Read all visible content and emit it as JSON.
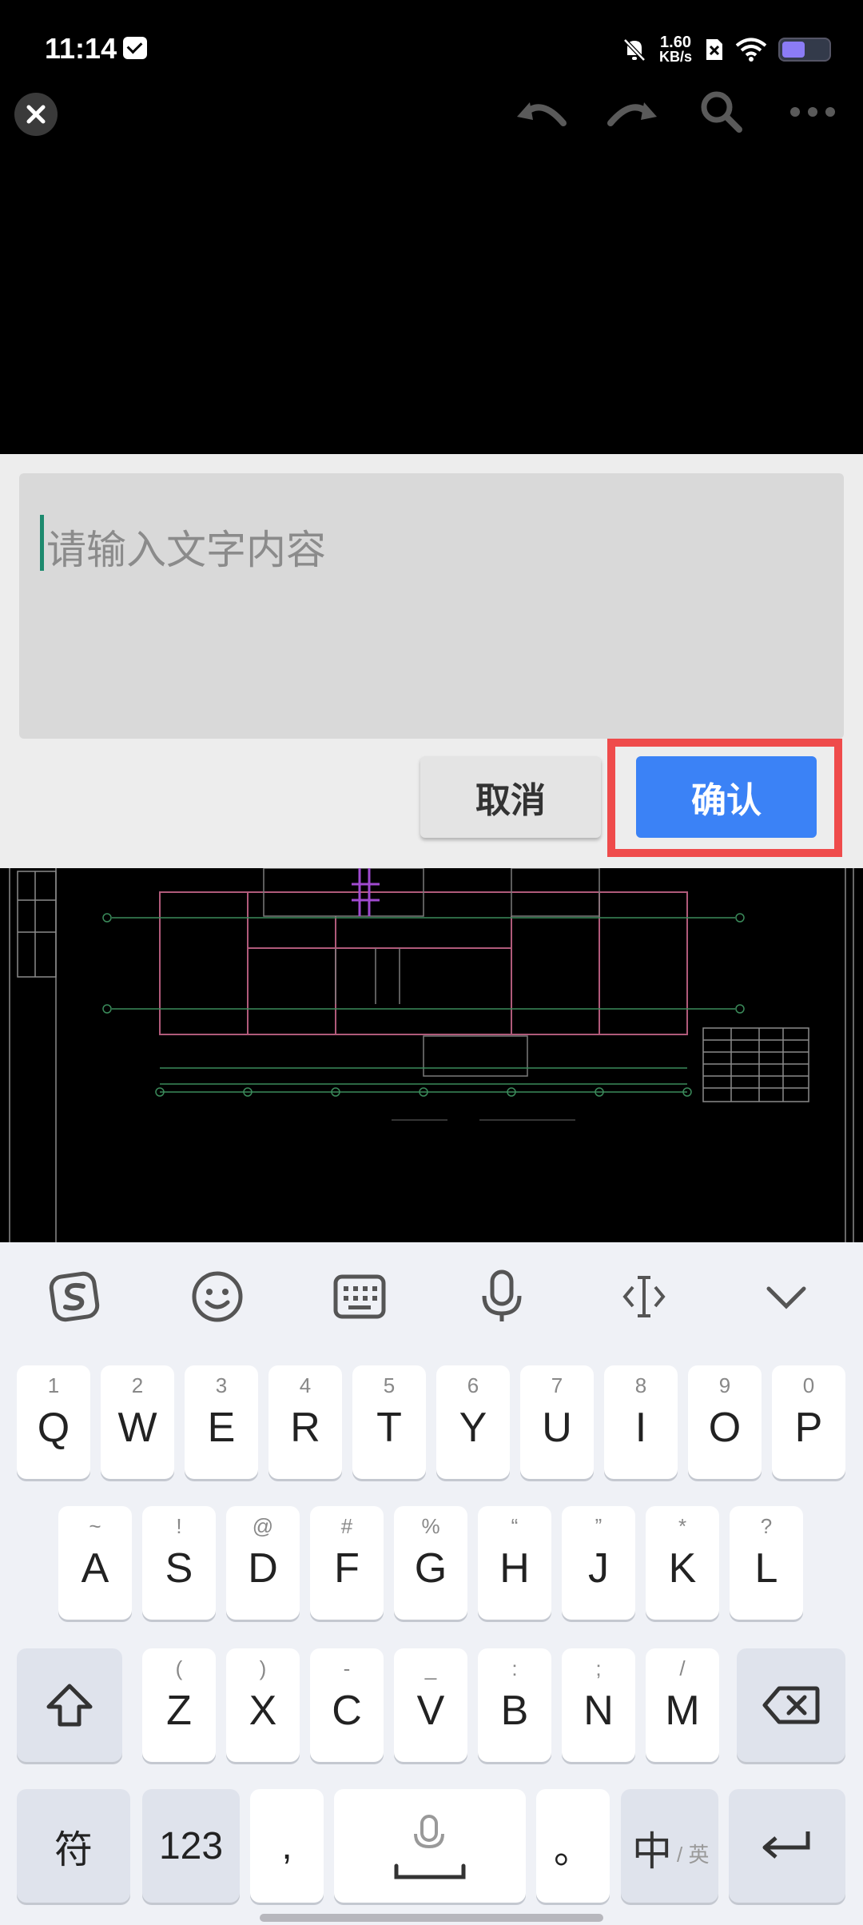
{
  "status_bar": {
    "time": "11:14",
    "net_speed_value": "1.60",
    "net_speed_unit": "KB/s"
  },
  "icons": {
    "close": "close-icon",
    "undo": "undo-icon",
    "redo": "redo-icon",
    "search": "search-icon",
    "more": "more-icon"
  },
  "text_panel": {
    "placeholder": "请输入文字内容",
    "cancel_label": "取消",
    "confirm_label": "确认"
  },
  "colors": {
    "confirm": "#3b82f6",
    "highlight": "#ef4b4b",
    "caret": "#1d8a6e"
  },
  "keyboard": {
    "row1": [
      {
        "main": "Q",
        "sub": "1"
      },
      {
        "main": "W",
        "sub": "2"
      },
      {
        "main": "E",
        "sub": "3"
      },
      {
        "main": "R",
        "sub": "4"
      },
      {
        "main": "T",
        "sub": "5"
      },
      {
        "main": "Y",
        "sub": "6"
      },
      {
        "main": "U",
        "sub": "7"
      },
      {
        "main": "I",
        "sub": "8"
      },
      {
        "main": "O",
        "sub": "9"
      },
      {
        "main": "P",
        "sub": "0"
      }
    ],
    "row2": [
      {
        "main": "A",
        "sub": "~"
      },
      {
        "main": "S",
        "sub": "!"
      },
      {
        "main": "D",
        "sub": "@"
      },
      {
        "main": "F",
        "sub": "#"
      },
      {
        "main": "G",
        "sub": "%"
      },
      {
        "main": "H",
        "sub": "“"
      },
      {
        "main": "J",
        "sub": "”"
      },
      {
        "main": "K",
        "sub": "*"
      },
      {
        "main": "L",
        "sub": "?"
      }
    ],
    "row3": [
      {
        "main": "Z",
        "sub": "("
      },
      {
        "main": "X",
        "sub": ")"
      },
      {
        "main": "C",
        "sub": "-"
      },
      {
        "main": "V",
        "sub": "_"
      },
      {
        "main": "B",
        "sub": ":"
      },
      {
        "main": "N",
        "sub": ";"
      },
      {
        "main": "M",
        "sub": "/"
      }
    ],
    "symbol_label": "符",
    "num_label": "123",
    "comma_label": ",",
    "period_label": "。",
    "lang_label": "中",
    "lang_sub": "/ 英"
  }
}
